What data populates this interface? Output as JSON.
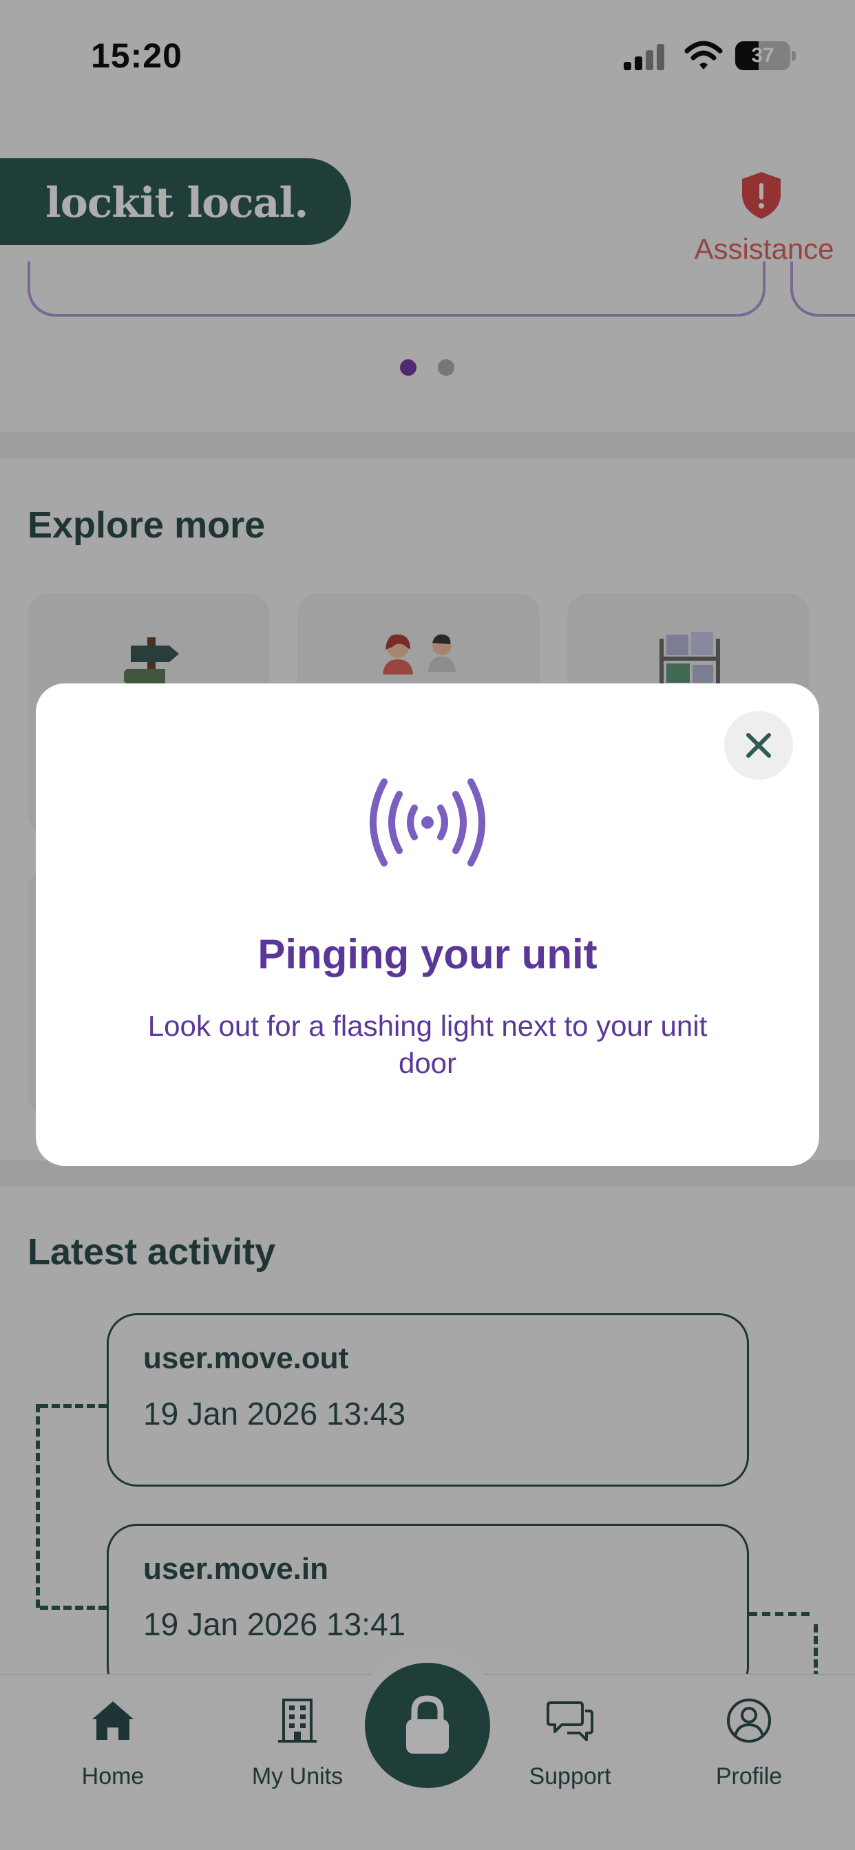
{
  "status_bar": {
    "time": "15:20",
    "battery": "37"
  },
  "header": {
    "logo_text": "lockit local.",
    "assistance_label": "Assistance"
  },
  "carousel": {
    "dots": 2,
    "active_dot": 1
  },
  "explore": {
    "title": "Explore more"
  },
  "activity": {
    "title": "Latest activity",
    "items": [
      {
        "event": "user.move.out",
        "time": "19 Jan 2026 13:43"
      },
      {
        "event": "user.move.in",
        "time": "19 Jan 2026 13:41"
      }
    ]
  },
  "tab_bar": {
    "tabs": [
      {
        "label": "Home",
        "icon": "home-icon"
      },
      {
        "label": "My Units",
        "icon": "building-icon"
      },
      {
        "label": "Support",
        "icon": "chat-icon"
      },
      {
        "label": "Profile",
        "icon": "profile-icon"
      }
    ],
    "center_icon": "lock-icon"
  },
  "modal": {
    "title": "Pinging your unit",
    "body": "Look out for a flashing light next to your unit door",
    "icon": "broadcast-icon",
    "close_icon": "close-icon"
  },
  "colors": {
    "brand_dark": "#2f5a55",
    "text_dark": "#2f4f4f",
    "accent_purple": "#7b5fc0",
    "modal_text": "#5b3898",
    "alert_red": "#e06464"
  }
}
